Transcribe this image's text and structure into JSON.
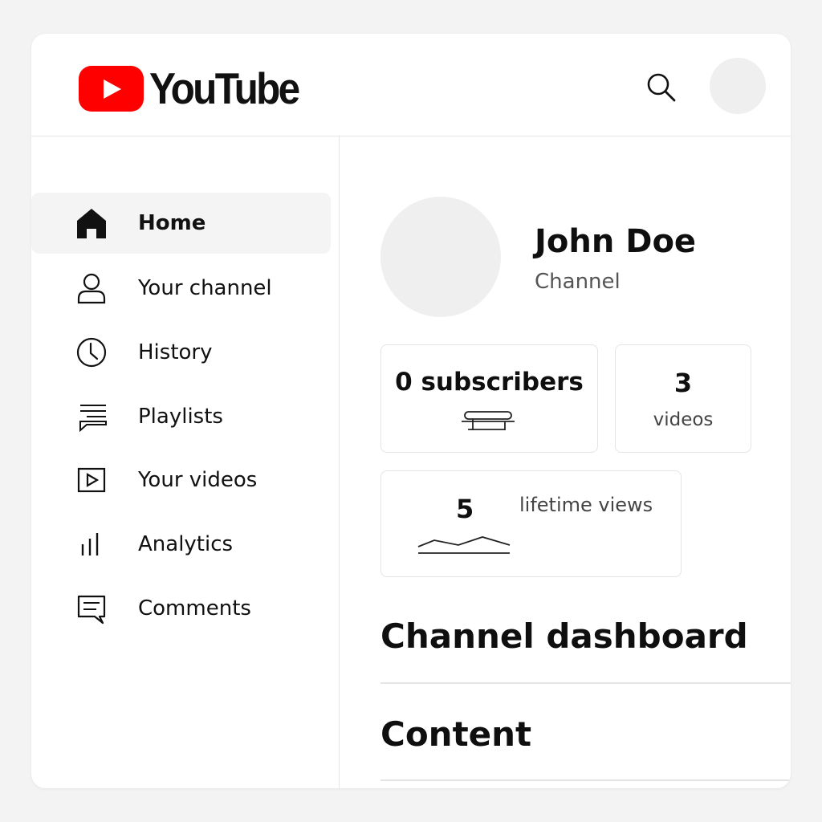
{
  "header": {
    "logo_text": "YouTube",
    "brand_color": "#ff0000",
    "search_icon": "search-icon"
  },
  "sidebar": {
    "items": [
      {
        "label": "Home",
        "icon": "home-icon",
        "active": true
      },
      {
        "label": "Your channel",
        "icon": "person-icon",
        "active": false
      },
      {
        "label": "History",
        "icon": "clock-icon",
        "active": false
      },
      {
        "label": "Playlists",
        "icon": "playlist-icon",
        "active": false
      },
      {
        "label": "Your videos",
        "icon": "video-icon",
        "active": false
      },
      {
        "label": "Analytics",
        "icon": "bar-chart-icon",
        "active": false
      },
      {
        "label": "Comments",
        "icon": "comment-icon",
        "active": false
      }
    ]
  },
  "channel": {
    "name": "John Doe",
    "type_label": "Channel"
  },
  "stats": {
    "subscribers": "0 subscribers",
    "videos_count": "3",
    "videos_label": "videos",
    "views_count": "5",
    "views_label": "lifetime views"
  },
  "sections": {
    "dashboard": "Channel dashboard",
    "content": "Content"
  }
}
